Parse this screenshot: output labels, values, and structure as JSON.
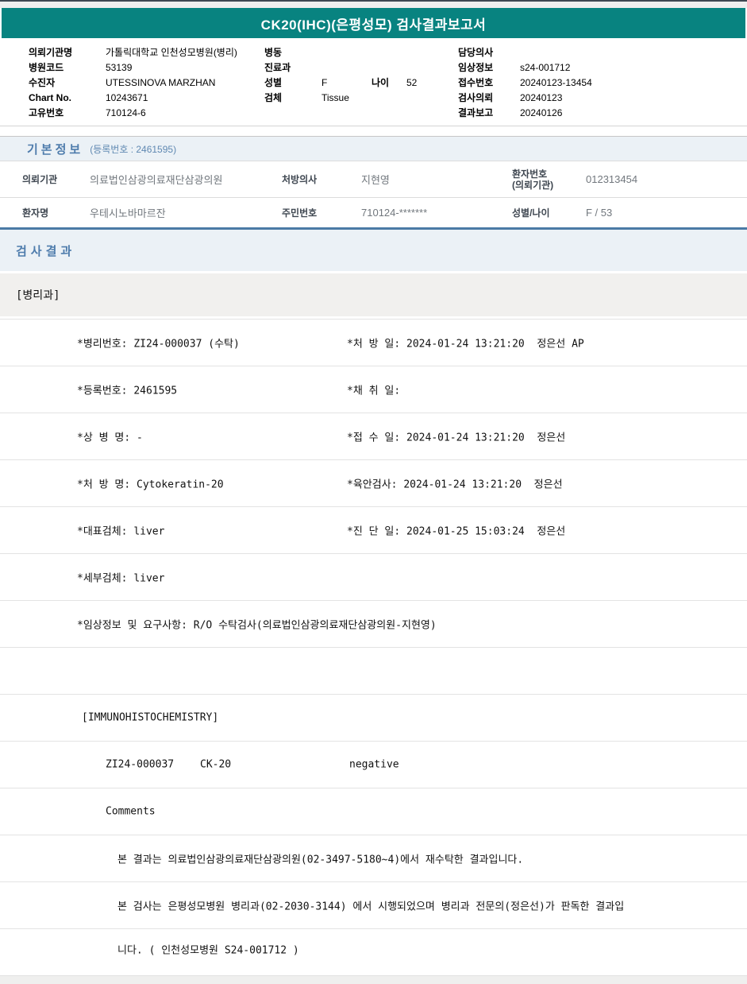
{
  "page": {
    "title": "CK20(IHC)(은평성모) 검사결과보고서"
  },
  "header": {
    "left": [
      {
        "label": "의뢰기관명",
        "value": "가톨릭대학교 인천성모병원(병리)"
      },
      {
        "label": "병원코드",
        "value": "53139"
      },
      {
        "label": "수진자",
        "value": "UTESSINOVA MARZHAN"
      },
      {
        "label": "Chart No.",
        "value": "10243671"
      },
      {
        "label": "고유번호",
        "value": "710124-6"
      }
    ],
    "middle": {
      "ward_label": "병동",
      "ward_value": "",
      "dept_label": "진료과",
      "dept_value": "",
      "sex_label": "성별",
      "sex_value": "F",
      "age_label": "나이",
      "age_value": "52",
      "specimen_label": "검체",
      "specimen_value": "Tissue"
    },
    "right": [
      {
        "label": "담당의사",
        "value": ""
      },
      {
        "label": "임상정보",
        "value": "s24-001712"
      },
      {
        "label": "접수번호",
        "value": "20240123-13454"
      },
      {
        "label": "검사의뢰",
        "value": "20240123"
      },
      {
        "label": "결과보고",
        "value": "20240126"
      }
    ]
  },
  "basic_info": {
    "title": "기본정보",
    "subtitle": "(등록번호 : 2461595)",
    "row1": {
      "l1": "의뢰기관",
      "v1": "의료법인삼광의료재단삼광의원",
      "l2": "처방의사",
      "v2": "지현영",
      "l3a": "환자번호",
      "l3b": "(의뢰기관)",
      "v3": "012313454"
    },
    "row2": {
      "l1": "환자명",
      "v1": "우테시노바마르잔",
      "l2": "주민번호",
      "v2": "710124-*******",
      "l3": "성별/나이",
      "v3": "F / 53"
    }
  },
  "results": {
    "section_title": "검사결과",
    "department": "[병리과]",
    "field_rows": [
      {
        "left": "*병리번호: ZI24-000037 (수탁)",
        "right": "*처 방 일: 2024-01-24 13:21:20  정은선 AP"
      },
      {
        "left": "*등록번호: 2461595",
        "right": "*채 취 일:"
      },
      {
        "left": "*상 병 명: -",
        "right": "*접 수 일: 2024-01-24 13:21:20  정은선"
      },
      {
        "left": "*처 방 명: Cytokeratin-20",
        "right": "*육안검사: 2024-01-24 13:21:20  정은선"
      },
      {
        "left": "*대표검체: liver",
        "right": "*진 단 일: 2024-01-25 15:03:24  정은선"
      },
      {
        "left": "*세부검체: liver",
        "right": ""
      },
      {
        "left": "*임상정보 및 요구사항: R/O 수탁검사(의료법인삼광의료재단삼광의원-지현영)",
        "right": ""
      }
    ],
    "ihc_header": "[IMMUNOHISTOCHEMISTRY]",
    "ihc_row": {
      "id": "ZI24-000037",
      "test": "CK-20",
      "result": "negative"
    },
    "comments_label": "Comments",
    "comment_lines": [
      "본 결과는 의료법인삼광의료재단삼광의원(02-3497-5180~4)에서 재수탁한 결과입니다.",
      "본 검사는 은평성모병원 병리과(02-2030-3144) 에서 시행되었으며 병리과 전문의(정은선)가 판독한 결과입",
      "니다. ( 인천성모병원 S24-001712 )"
    ]
  },
  "colors": {
    "teal": "#088380",
    "section_blue": "#4e7cac",
    "table_border_blue": "#4b7aa6",
    "section_bg": "#ebf1f6",
    "band_bg": "#f1f0ee"
  }
}
